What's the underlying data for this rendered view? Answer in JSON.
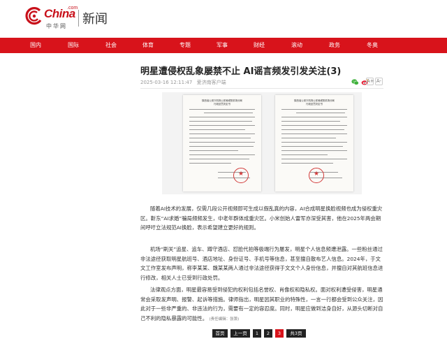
{
  "header": {
    "logo_text": "China",
    "logo_com": ".com",
    "logo_cn": "中华网",
    "section": "新闻"
  },
  "nav": {
    "items": [
      "国内",
      "国际",
      "社会",
      "体育",
      "专题",
      "军事",
      "财经",
      "滚动",
      "政务",
      "冬奥"
    ]
  },
  "article": {
    "title": "明星遭侵权乱象屡禁不止 AI谣言频发引发关注(3)",
    "date": "2025-03-16 12:11:47",
    "source": "爱济南客户端",
    "font_increase": "A+",
    "font_decrease": "A-",
    "doc_heading": "陕西省公安厅机场公安局咸阳机场分局\n行政处罚决定书",
    "paragraphs": [
      {
        "lead": "",
        "text": "随着AI技术的发展，仅需几段公开视频即可生成以假乱真的内容，AI合成明星换脸视频也成为侵权重灾区。靳东“AI求婚”骗局频频发生，中老年群体成重灾区。小米创始人雷军亦深受其害，他在2025年两会期间呼吁立法规范AI换脸，表示希望建立更好的规则。"
      },
      {
        "lead": "",
        "text": "机场“刷关”追星、追车、蹲守酒店、怼脸代拍等极端行为屡发，明星个人信息频遭泄露。一些粉丝通过非法途径获取明星航班号、酒店地址、身份证号、手机号等信息，甚至擅自散布艺人信息。2024年，于文文工作室发布声明，称李某某、魏某某两人通过非法途径获得于文文个人身份信息，并擅自对其航班信息进行修改，相关人士已受到行政处罚。"
      },
      {
        "lead": "",
        "text": "法律观点方面，明星最容易受到侵犯的权利包括名誉权、肖像权和隐私权。面对权利遭受侵害，明星通常会采取发声明、报警、起诉等措施。律师指出，明星因其职业的特殊性，一言一行都会受到公众关注，因此对于一些非严重的、非违法的行为，需要有一定的容忍度。同时，明星应做到洁身自好，从源头切断对自己不利的隐私暴露的可能性。",
        "editor": "(责任编辑：张箫)"
      }
    ]
  },
  "pager": {
    "first": "首页",
    "prev": "上一页",
    "pages": [
      "1",
      "2",
      "3"
    ],
    "current": "3",
    "total": "共3页"
  },
  "colors": {
    "brand_red": "#d8131b",
    "text": "#333333",
    "meta": "#999999"
  },
  "icons": {
    "logo": "china-com-swirl-icon",
    "wechat": "wechat-icon",
    "weibo": "weibo-icon"
  }
}
